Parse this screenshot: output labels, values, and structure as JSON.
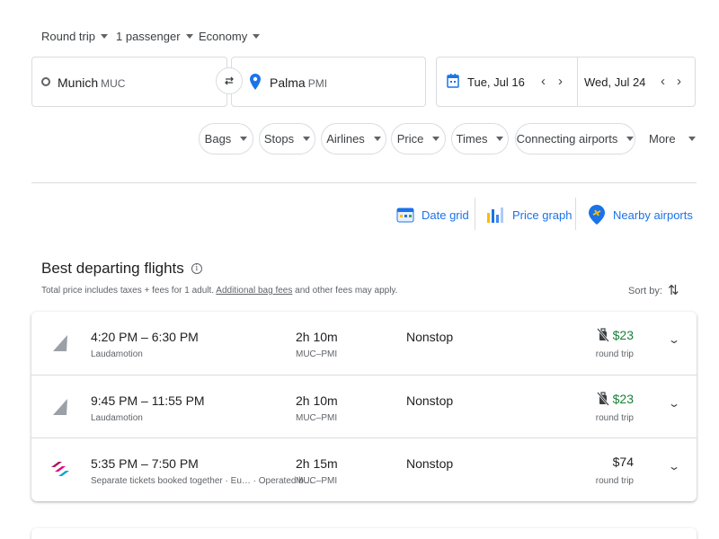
{
  "search": {
    "trip_type": "Round trip",
    "passengers": "1 passenger",
    "cabin": "Economy",
    "origin_city": "Munich",
    "origin_code": "MUC",
    "dest_city": "Palma",
    "dest_code": "PMI",
    "depart_date": "Tue, Jul 16",
    "return_date": "Wed, Jul 24"
  },
  "filters": [
    "Bags",
    "Stops",
    "Airlines",
    "Price",
    "Times",
    "Connecting airports"
  ],
  "filters_more": "More",
  "tools": {
    "date_grid": "Date grid",
    "price_graph": "Price graph",
    "nearby_airports": "Nearby airports"
  },
  "results": {
    "title": "Best departing flights",
    "subtitle_pre": "Total price includes taxes + fees for 1 adult. ",
    "subtitle_link": "Additional bag fees",
    "subtitle_post": " and other fees may apply.",
    "sort_label": "Sort by:"
  },
  "flights": [
    {
      "times": "4:20 PM – 6:30 PM",
      "airline": "Laudamotion",
      "duration": "2h 10m",
      "route": "MUC–PMI",
      "stops": "Nonstop",
      "price": "$23",
      "price_note": "round trip",
      "low_price": true,
      "logo": "laudamotion-logo"
    },
    {
      "times": "9:45 PM – 11:55 PM",
      "airline": "Laudamotion",
      "duration": "2h 10m",
      "route": "MUC–PMI",
      "stops": "Nonstop",
      "price": "$23",
      "price_note": "round trip",
      "low_price": true,
      "logo": "laudamotion-logo"
    },
    {
      "times": "5:35 PM – 7:50 PM",
      "airline": "Separate tickets booked together · Eu…  · Operated b…",
      "duration": "2h 15m",
      "route": "MUC–PMI",
      "stops": "Nonstop",
      "price": "$74",
      "price_note": "round trip",
      "low_price": false,
      "logo": "eurowings-logo"
    }
  ],
  "colors": {
    "accent": "#1a73e8",
    "low_price": "#188038",
    "border": "#dadce0"
  }
}
